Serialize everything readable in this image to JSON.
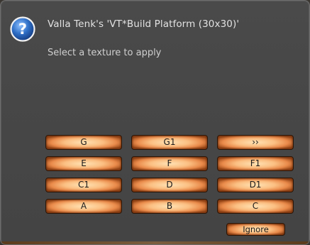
{
  "dialog": {
    "title": "Valla Tenk's 'VT*Build Platform (30x30)'",
    "message": "Select a texture to apply",
    "icon": "question-icon"
  },
  "buttons": {
    "row1": [
      "G",
      "G1",
      "››"
    ],
    "row2": [
      "E",
      "F",
      "F1"
    ],
    "row3": [
      "C1",
      "D",
      "D1"
    ],
    "row4": [
      "A",
      "B",
      "C"
    ],
    "ignore": "Ignore"
  },
  "colors": {
    "dialog_bg": "#474747",
    "button_glow": "#fbbf82",
    "button_edge": "#9a4818",
    "icon_blue": "#2f6fc6"
  }
}
